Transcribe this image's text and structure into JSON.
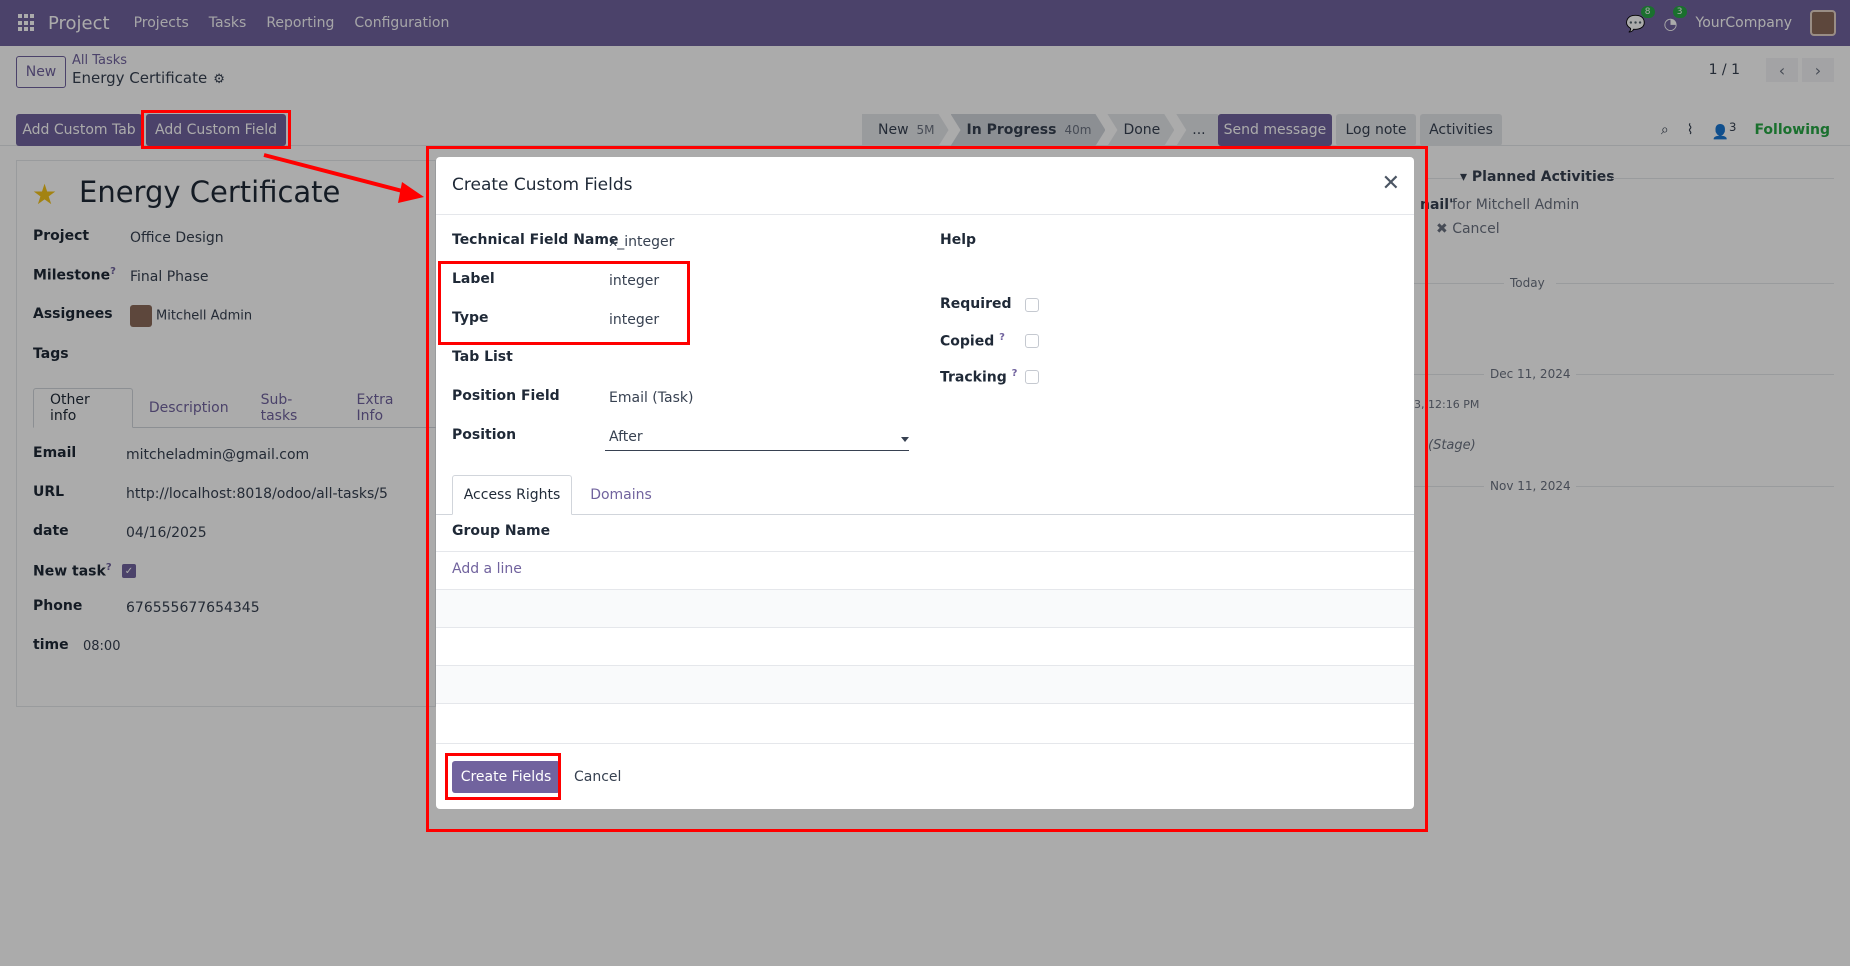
{
  "navbar": {
    "brand": "Project",
    "menus": [
      "Projects",
      "Tasks",
      "Reporting",
      "Configuration"
    ],
    "chat_count": "8",
    "activity_count": "3",
    "company": "YourCompany"
  },
  "control_panel": {
    "new_label": "New",
    "breadcrumb_parent": "All Tasks",
    "breadcrumb_current": "Energy Certificate",
    "pager": "1 / 1",
    "add_custom_tab": "Add Custom Tab",
    "add_custom_field": "Add Custom Field",
    "stages": [
      {
        "name": "New",
        "time": "5M"
      },
      {
        "name": "In Progress",
        "time": "40m"
      },
      {
        "name": "Done",
        "time": ""
      },
      {
        "name": "...",
        "time": ""
      }
    ],
    "send_message": "Send message",
    "log_note": "Log note",
    "activities": "Activities",
    "followers_count": "3",
    "following": "Following"
  },
  "record": {
    "title": "Energy Certificate",
    "fields": {
      "project_label": "Project",
      "project_value": "Office Design",
      "milestone_label": "Milestone",
      "milestone_value": "Final Phase",
      "assignees_label": "Assignees",
      "assignees_value": "Mitchell Admin",
      "tags_label": "Tags"
    },
    "tabs": [
      "Other info",
      "Description",
      "Sub-tasks",
      "Extra Info"
    ],
    "other_info": {
      "email_label": "Email",
      "email_value": "mitcheladmin@gmail.com",
      "url_label": "URL",
      "url_value": "http://localhost:8018/odoo/all-tasks/5",
      "date_label": "date",
      "date_value": "04/16/2025",
      "new_task_label": "New task",
      "phone_label": "Phone",
      "phone_value": "676555677654345",
      "time_label": "time",
      "time_value": "08:00"
    }
  },
  "chatter": {
    "planned_activities": "Planned Activities",
    "activity_fragment": "nail\"",
    "activity_user": "for Mitchell Admin",
    "cancel": "Cancel",
    "today": "Today",
    "dec_date": "Dec 11, 2024",
    "dec_time": "3, 12:16 PM",
    "stage_text": "(Stage)",
    "nov_date": "Nov 11, 2024"
  },
  "modal": {
    "title": "Create Custom Fields",
    "technical_name_label": "Technical Field Name",
    "technical_name_value": "x_integer",
    "label_label": "Label",
    "label_value": "integer",
    "type_label": "Type",
    "type_value": "integer",
    "tab_list_label": "Tab List",
    "position_field_label": "Position Field",
    "position_field_value": "Email (Task)",
    "position_label": "Position",
    "position_value": "After",
    "help_label": "Help",
    "required_label": "Required",
    "copied_label": "Copied",
    "tracking_label": "Tracking",
    "tabs": [
      "Access Rights",
      "Domains"
    ],
    "group_name_header": "Group Name",
    "add_line": "Add a line",
    "create_button": "Create Fields",
    "cancel_button": "Cancel"
  },
  "colors": {
    "brand": "#71639e",
    "annotation": "#ff0000",
    "following": "#28a745"
  }
}
